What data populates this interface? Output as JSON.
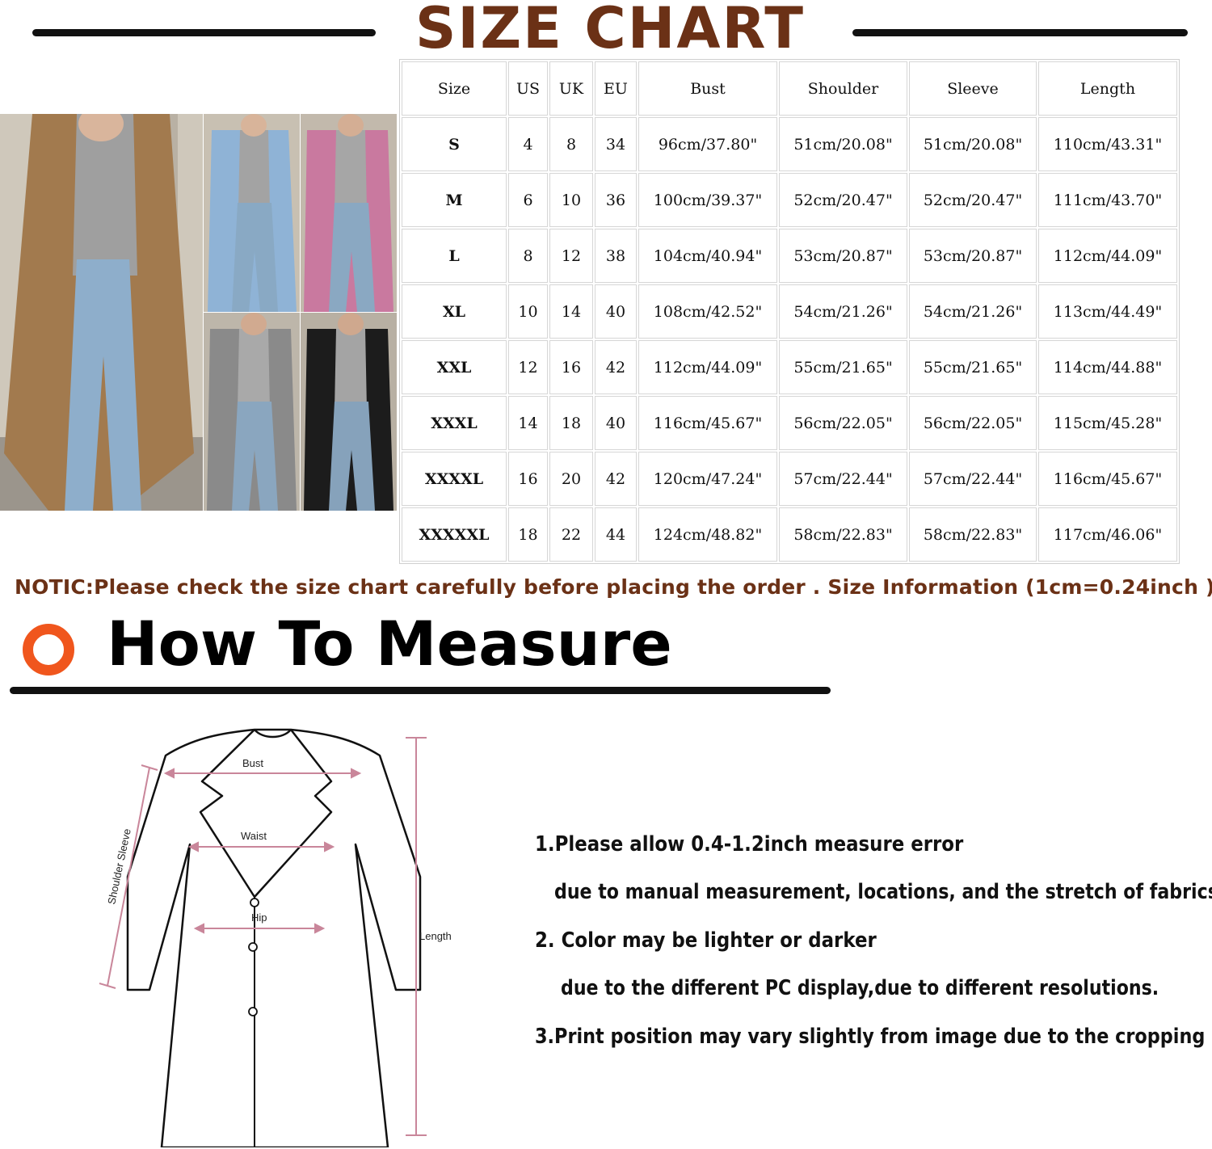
{
  "header": {
    "title": "SIZE CHART"
  },
  "table": {
    "headers": [
      "Size",
      "US",
      "UK",
      "EU",
      "Bust",
      "Shoulder",
      "Sleeve",
      "Length"
    ],
    "rows": [
      [
        "S",
        "4",
        "8",
        "34",
        "96cm/37.80\"",
        "51cm/20.08\"",
        "51cm/20.08\"",
        "110cm/43.31\""
      ],
      [
        "M",
        "6",
        "10",
        "36",
        "100cm/39.37\"",
        "52cm/20.47\"",
        "52cm/20.47\"",
        "111cm/43.70\""
      ],
      [
        "L",
        "8",
        "12",
        "38",
        "104cm/40.94\"",
        "53cm/20.87\"",
        "53cm/20.87\"",
        "112cm/44.09\""
      ],
      [
        "XL",
        "10",
        "14",
        "40",
        "108cm/42.52\"",
        "54cm/21.26\"",
        "54cm/21.26\"",
        "113cm/44.49\""
      ],
      [
        "XXL",
        "12",
        "16",
        "42",
        "112cm/44.09\"",
        "55cm/21.65\"",
        "55cm/21.65\"",
        "114cm/44.88\""
      ],
      [
        "XXXL",
        "14",
        "18",
        "40",
        "116cm/45.67\"",
        "56cm/22.05\"",
        "56cm/22.05\"",
        "115cm/45.28\""
      ],
      [
        "XXXXL",
        "16",
        "20",
        "42",
        "120cm/47.24\"",
        "57cm/22.44\"",
        "57cm/22.44\"",
        "116cm/45.67\""
      ],
      [
        "XXXXXL",
        "18",
        "22",
        "44",
        "124cm/48.82\"",
        "58cm/22.83\"",
        "58cm/22.83\"",
        "117cm/46.06\""
      ]
    ]
  },
  "notice": "NOTIC:Please check the size chart carefully before placing the order . Size Information (1cm=0.24inch )",
  "measure": {
    "title": "How To Measure",
    "diagram_labels": {
      "bust": "Bust",
      "waist": "Waist",
      "hip": "Hip",
      "shoulder_sleeve": "Shoulder Sleeve",
      "length": "Length"
    }
  },
  "notes": [
    "1.Please allow 0.4-1.2inch measure error",
    "due to manual measurement, locations, and the stretch of fabrics",
    "2. Color may be lighter or darker",
    "due to the different PC display,due to different resolutions.",
    "3.Print position may vary slightly from image due to the cropping"
  ],
  "colors": {
    "title_brown": "#6b3116",
    "bullet_orange": "#f0561d",
    "measure_pink": "#c9869a",
    "coat_camel": "#a27a4e",
    "coat_blue": "#8fb3d6",
    "coat_pink": "#c9799f",
    "coat_gray": "#8a8a8a",
    "coat_black": "#1c1c1c"
  }
}
